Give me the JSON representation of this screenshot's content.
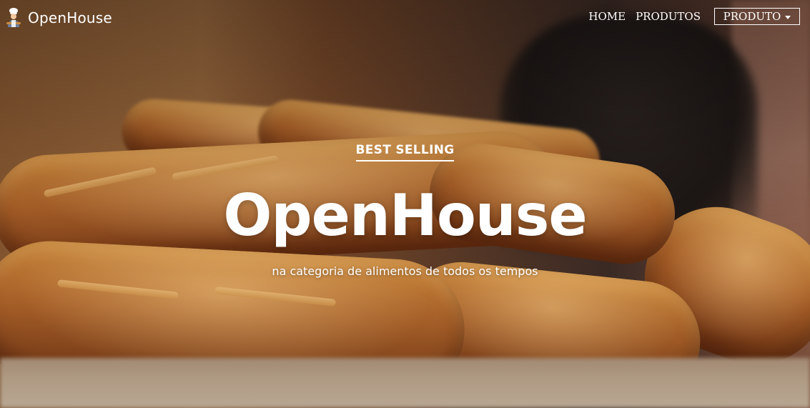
{
  "navbar": {
    "brand": {
      "icon": "baker-chef-icon",
      "name": "OpenHouse"
    },
    "links": [
      {
        "label": "HOME"
      },
      {
        "label": "PRODUTOS"
      }
    ],
    "dropdown": {
      "label": "PRODUTO",
      "icon": "caret-down-icon"
    }
  },
  "hero": {
    "eyebrow": "BEST SELLING",
    "title": "OpenHouse",
    "subtitle": "na categoria de alimentos de todos os tempos",
    "background": "baguettes-photo"
  },
  "colors": {
    "text": "#ffffff",
    "bread": "#b0642a"
  }
}
